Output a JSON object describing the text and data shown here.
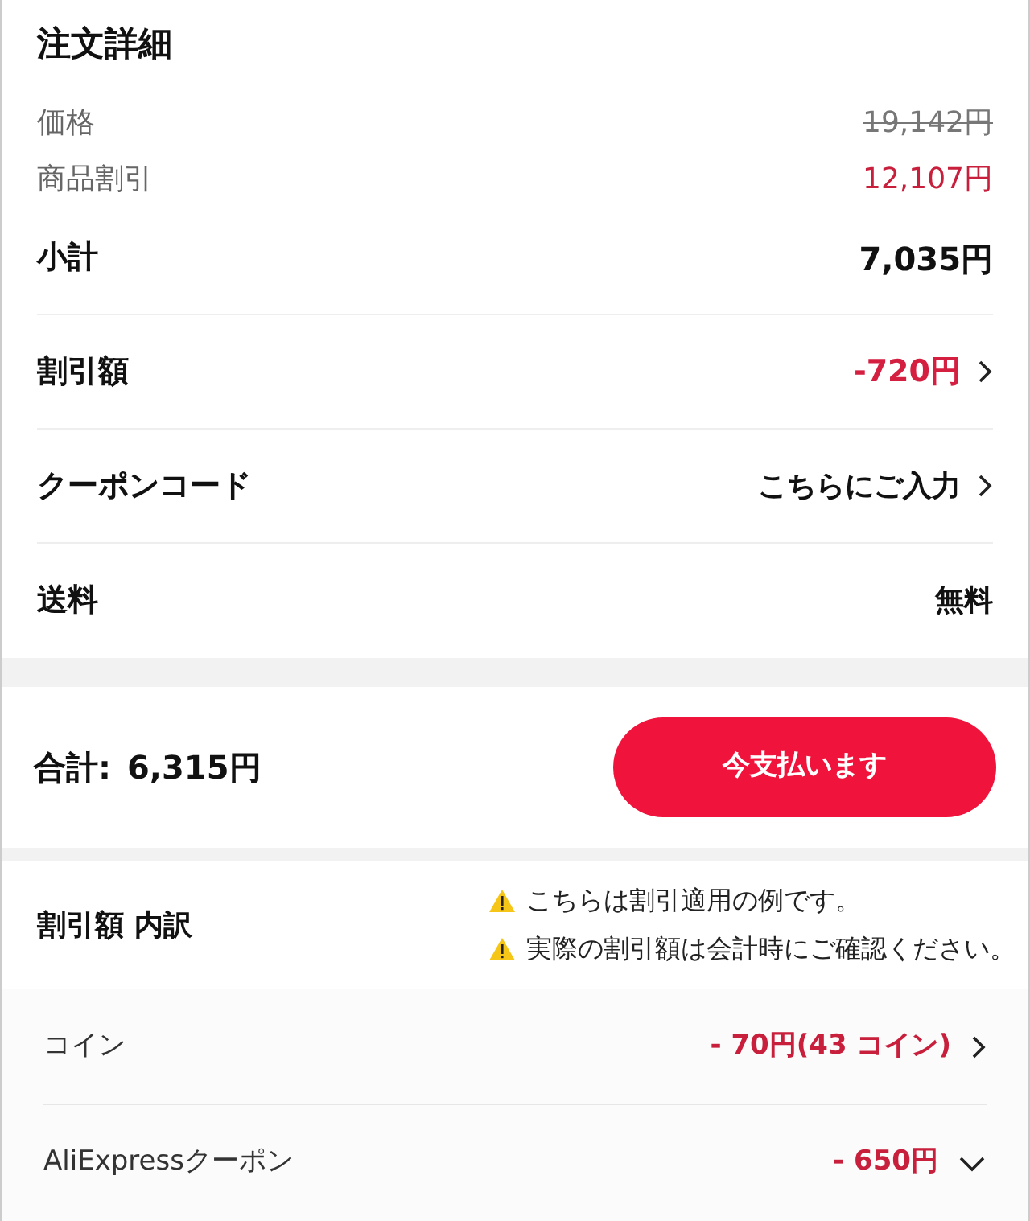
{
  "order_details": {
    "title": "注文詳細",
    "price_rows": [
      {
        "label": "価格",
        "value": "19,142円",
        "kind": "original"
      },
      {
        "label": "商品割引",
        "value": "12,107円",
        "kind": "discount"
      }
    ],
    "subtotal": {
      "label": "小計",
      "value": "7,035円"
    },
    "rows": [
      {
        "label": "割引額",
        "value": "-720円",
        "kind": "discount",
        "chevron": true
      },
      {
        "label": "クーポンコード",
        "value": "こちらにご入力",
        "kind": "plain",
        "chevron": true
      },
      {
        "label": "送料",
        "value": "無料",
        "kind": "plain",
        "chevron": false
      }
    ]
  },
  "total": {
    "label": "合計:",
    "amount": "6,315円",
    "button": "今支払います"
  },
  "breakdown": {
    "title": "割引額 内訳",
    "notes": [
      "こちらは割引適用の例です。",
      "実際の割引額は会計時にご確認ください。"
    ],
    "items": [
      {
        "label": "コイン",
        "value": "- 70円(43 コイン)",
        "kind": "link"
      },
      {
        "label": "AliExpressクーポン",
        "value": "- 650円",
        "kind": "dropdown"
      }
    ]
  }
}
